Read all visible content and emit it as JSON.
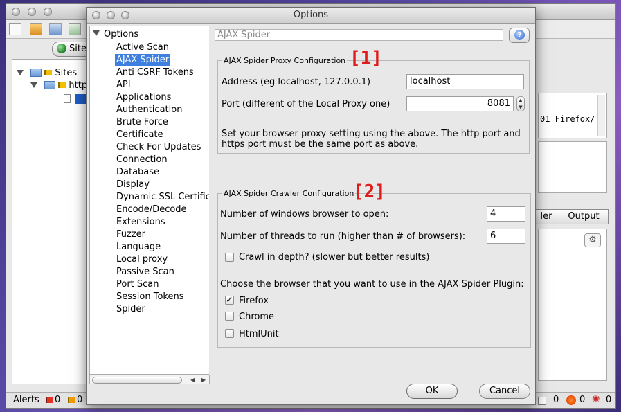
{
  "dialog": {
    "title": "Options",
    "tree_root": "Options",
    "tree_items": [
      "Active Scan",
      "AJAX Spider",
      "Anti CSRF Tokens",
      "API",
      "Applications",
      "Authentication",
      "Brute Force",
      "Certificate",
      "Check For Updates",
      "Connection",
      "Database",
      "Display",
      "Dynamic SSL Certificate",
      "Encode/Decode",
      "Extensions",
      "Fuzzer",
      "Language",
      "Local proxy",
      "Passive Scan",
      "Port Scan",
      "Session Tokens",
      "Spider"
    ],
    "selected_item": "AJAX Spider",
    "panel_title": "AJAX Spider",
    "proxy": {
      "legend": "AJAX Spider Proxy Configuration",
      "address_label": "Address (eg localhost, 127.0.0.1)",
      "address_value": "localhost",
      "port_label": "Port (different of the Local Proxy one)",
      "port_value": "8081",
      "note_line1": "Set your browser proxy setting using the above. The http port and",
      "note_line2": "https port must be the same port as above."
    },
    "crawler": {
      "legend": "AJAX Spider Crawler Configuration",
      "windows_label": "Number of windows browser to open:",
      "windows_value": "4",
      "threads_label": "Number of threads to run (higher than # of browsers):",
      "threads_value": "6",
      "depth_label": "Crawl in depth? (slower but better results)",
      "depth_checked": false,
      "browser_prompt": "Choose the browser that you want to use in the AJAX Spider Plugin:",
      "browsers": [
        {
          "label": "Firefox",
          "checked": true
        },
        {
          "label": "Chrome",
          "checked": false
        },
        {
          "label": "HtmlUnit",
          "checked": false
        }
      ]
    },
    "annotations": {
      "one": "[1]",
      "two": "[2]"
    },
    "buttons": {
      "ok": "OK",
      "cancel": "Cancel"
    }
  },
  "background": {
    "sites_tab": "Site",
    "tree_sites": "Sites",
    "tree_http": "http:",
    "right_text": "01 Firefox/",
    "tab_partial": "ler",
    "tab_output": "Output",
    "status": {
      "alerts_label": "Alerts",
      "alerts_high": "0",
      "alerts_medium": "0",
      "right_count1": "0",
      "right_count2": "0",
      "right_count3": "0"
    }
  },
  "colors": {
    "selection": "#3d80df",
    "annotation": "#e01b1b"
  }
}
